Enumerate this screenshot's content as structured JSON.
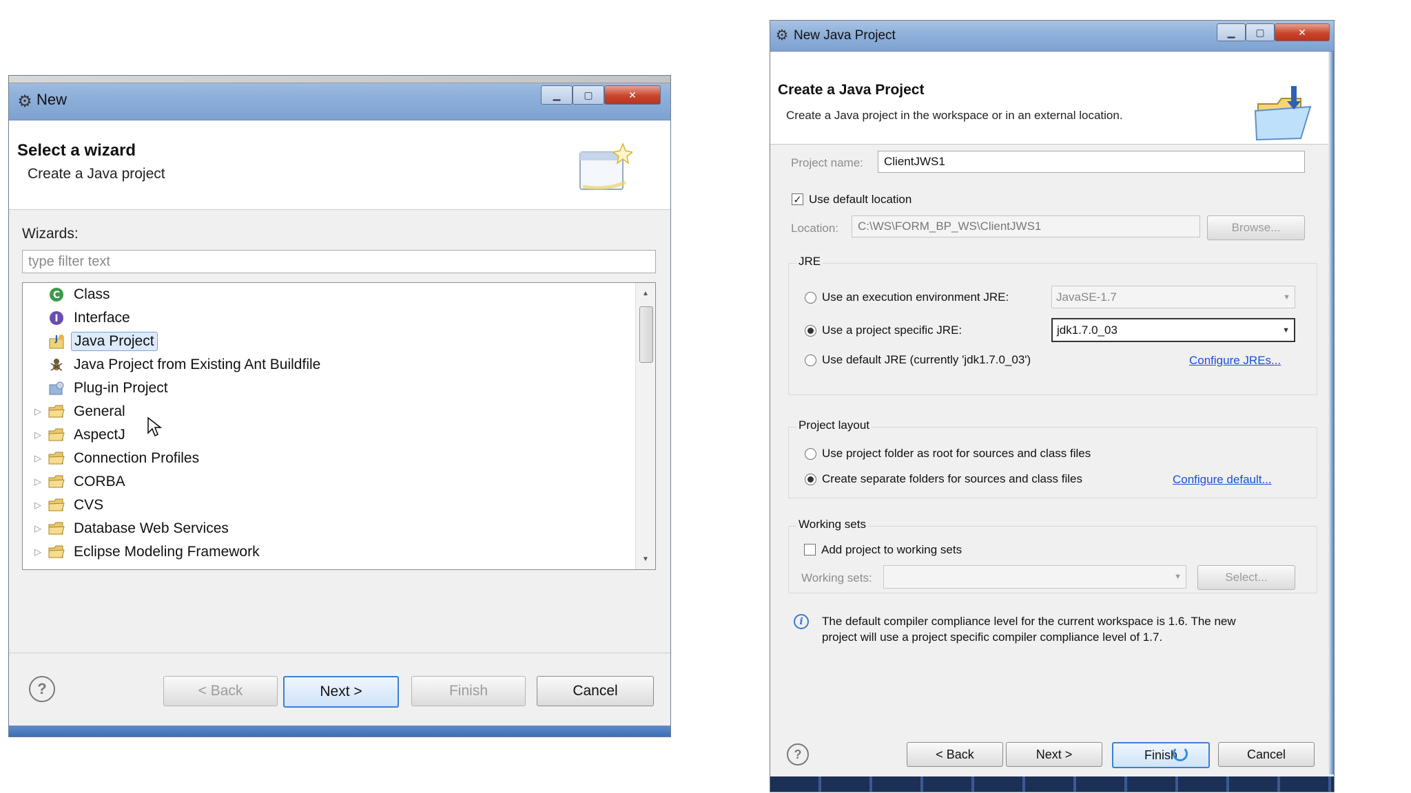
{
  "left_dialog": {
    "title": "New",
    "header_title": "Select a wizard",
    "header_subtitle": "Create a Java project",
    "wizards_label": "Wizards:",
    "filter_placeholder": "type filter text",
    "tree_items": [
      {
        "label": "Class",
        "icon": "class-icon",
        "expandable": false,
        "selected": false
      },
      {
        "label": "Interface",
        "icon": "interface-icon",
        "expandable": false,
        "selected": false
      },
      {
        "label": "Java Project",
        "icon": "java-project-icon",
        "expandable": false,
        "selected": true
      },
      {
        "label": "Java Project from Existing Ant Buildfile",
        "icon": "ant-icon",
        "expandable": false,
        "selected": false
      },
      {
        "label": "Plug-in Project",
        "icon": "plugin-icon",
        "expandable": false,
        "selected": false
      },
      {
        "label": "General",
        "icon": "folder-icon",
        "expandable": true,
        "selected": false
      },
      {
        "label": "AspectJ",
        "icon": "folder-icon",
        "expandable": true,
        "selected": false
      },
      {
        "label": "Connection Profiles",
        "icon": "folder-icon",
        "expandable": true,
        "selected": false
      },
      {
        "label": "CORBA",
        "icon": "folder-icon",
        "expandable": true,
        "selected": false
      },
      {
        "label": "CVS",
        "icon": "folder-icon",
        "expandable": true,
        "selected": false
      },
      {
        "label": "Database Web Services",
        "icon": "folder-icon",
        "expandable": true,
        "selected": false
      },
      {
        "label": "Eclipse Modeling Framework",
        "icon": "folder-icon",
        "expandable": true,
        "selected": false
      }
    ],
    "buttons": {
      "help": "?",
      "back": "< Back",
      "next": "Next >",
      "finish": "Finish",
      "cancel": "Cancel"
    }
  },
  "right_dialog": {
    "title": "New Java Project",
    "header_title": "Create a Java Project",
    "header_subtitle": "Create a Java project in the workspace or in an external location.",
    "project_name_label": "Project name:",
    "project_name_value": "ClientJWS1",
    "use_default_location_label": "Use default location",
    "use_default_location_checked": true,
    "location_label": "Location:",
    "location_value": "C:\\WS\\FORM_BP_WS\\ClientJWS1",
    "browse_label": "Browse...",
    "jre_group": {
      "title": "JRE",
      "option_env_label": "Use an execution environment JRE:",
      "option_env_value": "JavaSE-1.7",
      "option_specific_label": "Use a project specific JRE:",
      "option_specific_value": "jdk1.7.0_03",
      "option_default_label": "Use default JRE (currently 'jdk1.7.0_03')",
      "configure_link": "Configure JREs...",
      "selected": "specific"
    },
    "layout_group": {
      "title": "Project layout",
      "option_root_label": "Use project folder as root for sources and class files",
      "option_separate_label": "Create separate folders for sources and class files",
      "configure_link": "Configure default...",
      "selected": "separate"
    },
    "working_sets_group": {
      "title": "Working sets",
      "add_label": "Add project to working sets",
      "add_checked": false,
      "sets_label": "Working sets:",
      "sets_value": "",
      "select_label": "Select..."
    },
    "info_text_line1": "The default compiler compliance level for the current workspace is 1.6. The new",
    "info_text_line2": "project will use a project specific compiler compliance level of 1.7.",
    "buttons": {
      "help": "?",
      "back": "< Back",
      "next": "Next >",
      "finish": "Finish",
      "cancel": "Cancel"
    }
  },
  "colors": {
    "titlebar": "#8fb0da",
    "close_button": "#c8452c",
    "link": "#1a4fd6",
    "default_button_border": "#3b7fd1",
    "selection": "#dceafc"
  }
}
